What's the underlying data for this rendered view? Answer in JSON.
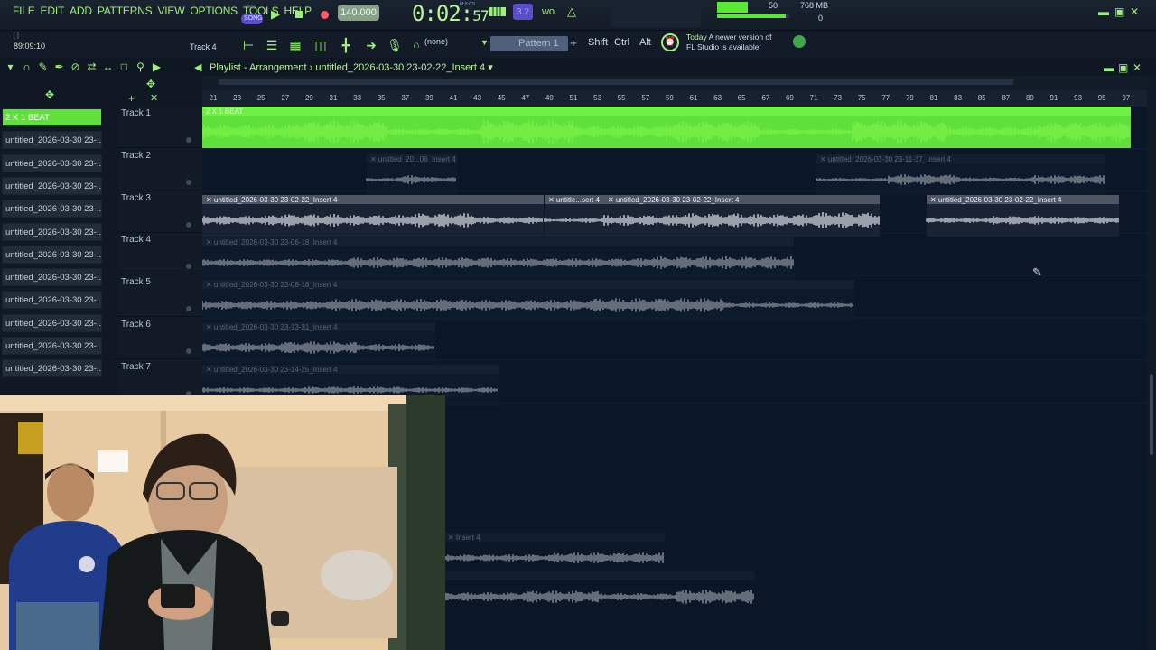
{
  "menu": [
    "FILE",
    "EDIT",
    "ADD",
    "PATTERNS",
    "VIEW",
    "OPTIONS",
    "TOOLS",
    "HELP"
  ],
  "transport": {
    "pat_song_label": "SONG",
    "tempo": "140.000",
    "time": "0:02",
    "time_small": "57",
    "time_unit": "M:S:CS"
  },
  "meters": {
    "volume": "50",
    "memory": "768 MB",
    "cpu": "0"
  },
  "bar2": {
    "hint": "[ ]",
    "position": "89:09:10",
    "track_label": "Track 4",
    "snap_value": "(none)",
    "pattern": "Pattern 1",
    "keys": [
      "Shift",
      "Ctrl",
      "Alt"
    ],
    "news_day": "Today",
    "news_line1": "A newer version of",
    "news_line2": "FL Studio is available!"
  },
  "playlist": {
    "title": "Playlist - Arrangement",
    "song_title": "untitled_2026-03-30 23-02-22_Insert 4"
  },
  "sidebar_items": [
    "2 X 1 BEAT",
    "untitled_2026-03-30 23-...",
    "untitled_2026-03-30 23-...",
    "untitled_2026-03-30 23-...",
    "untitled_2026-03-30 23-...",
    "untitled_2026-03-30 23-...",
    "untitled_2026-03-30 23-...",
    "untitled_2026-03-30 23-...",
    "untitled_2026-03-30 23-...",
    "untitled_2026-03-30 23-...",
    "untitled_2026-03-30 23-...",
    "untitled_2026-03-30 23-..."
  ],
  "tracks": [
    "Track 1",
    "Track 2",
    "Track 3",
    "Track 4",
    "Track 5",
    "Track 6",
    "Track 7"
  ],
  "ruler": [
    "21",
    "23",
    "25",
    "27",
    "29",
    "31",
    "33",
    "35",
    "37",
    "39",
    "41",
    "43",
    "45",
    "47",
    "49",
    "51",
    "53",
    "55",
    "57",
    "59",
    "61",
    "63",
    "65",
    "67",
    "69",
    "71",
    "73",
    "75",
    "77",
    "79",
    "81",
    "83",
    "85",
    "87",
    "89",
    "91",
    "93",
    "95",
    "97"
  ],
  "clips": [
    {
      "track": 0,
      "label": "2 X 1 BEAT",
      "style": "green"
    },
    {
      "track": 1,
      "label": "untitled_20...06_Insert 4",
      "style": "mute"
    },
    {
      "track": 1,
      "label": "untitled_2026-03-30 23-11-37_Insert 4",
      "style": "mute"
    },
    {
      "track": 2,
      "label": "untitled_2026-03-30 23-02-22_Insert 4",
      "style": "gray"
    },
    {
      "track": 2,
      "label": "untitle...sert 4",
      "style": "gray"
    },
    {
      "track": 2,
      "label": "untitled_2026-03-30 23-02-22_Insert 4",
      "style": "gray"
    },
    {
      "track": 2,
      "label": "untitled_2026-03-30 23-02-22_Insert 4",
      "style": "gray"
    },
    {
      "track": 3,
      "label": "untitled_2026-03-30 23-06-18_Insert 4",
      "style": "mute"
    },
    {
      "track": 4,
      "label": "untitled_2026-03-30 23-08-18_Insert 4",
      "style": "mute"
    },
    {
      "track": 5,
      "label": "untitled_2026-03-30 23-13-31_Insert 4",
      "style": "mute"
    },
    {
      "track": 6,
      "label": "untitled_2026-03-30 23-14-25_Insert 4",
      "style": "mute"
    },
    {
      "track": 9,
      "label": "Insert 4",
      "style": "mute"
    },
    {
      "track": 10,
      "label": "",
      "style": "mute"
    }
  ],
  "colors": {
    "accent_green": "#5fe03a",
    "wave_green": "#7cf24a",
    "wave_gray": "#c9ced6"
  }
}
